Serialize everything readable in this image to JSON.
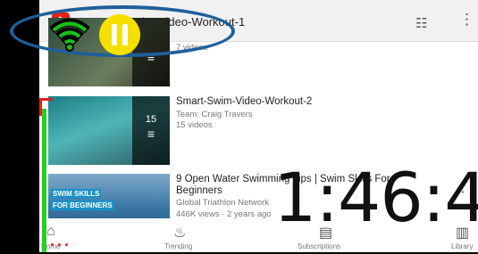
{
  "header": {
    "playlist_title": "Smart-Swim-Video-Workout-1",
    "tune_icon": "tune-icon",
    "more_icon": "more-vert-icon"
  },
  "playlists": [
    {
      "title": "",
      "channel": "",
      "meta": "7 videos"
    },
    {
      "title": "Smart-Swim-Video-Workout-2",
      "channel": "Team: Craig Travers",
      "meta": "15 videos",
      "count": "15"
    },
    {
      "title": "9 Open Water Swimming Tips | Swim Skills For Beginners",
      "channel": "Global Triathlon Network",
      "meta": "446K views · 2 years ago",
      "thumb_caption_1": "SWIM SKILLS",
      "thumb_caption_2": "FOR BEGINNERS"
    }
  ],
  "bottom_nav": [
    {
      "label": "Home",
      "icon": "home-icon"
    },
    {
      "label": "Trending",
      "icon": "flame-icon"
    },
    {
      "label": "Subscriptions",
      "icon": "subscriptions-icon"
    },
    {
      "label": "Library",
      "icon": "library-icon"
    }
  ],
  "overlay": {
    "timer": "1:46:4",
    "colors": {
      "ring": "#1f5f9a",
      "pause": "#f5e000",
      "progress": "#22d022",
      "alert": "#e02020"
    }
  }
}
